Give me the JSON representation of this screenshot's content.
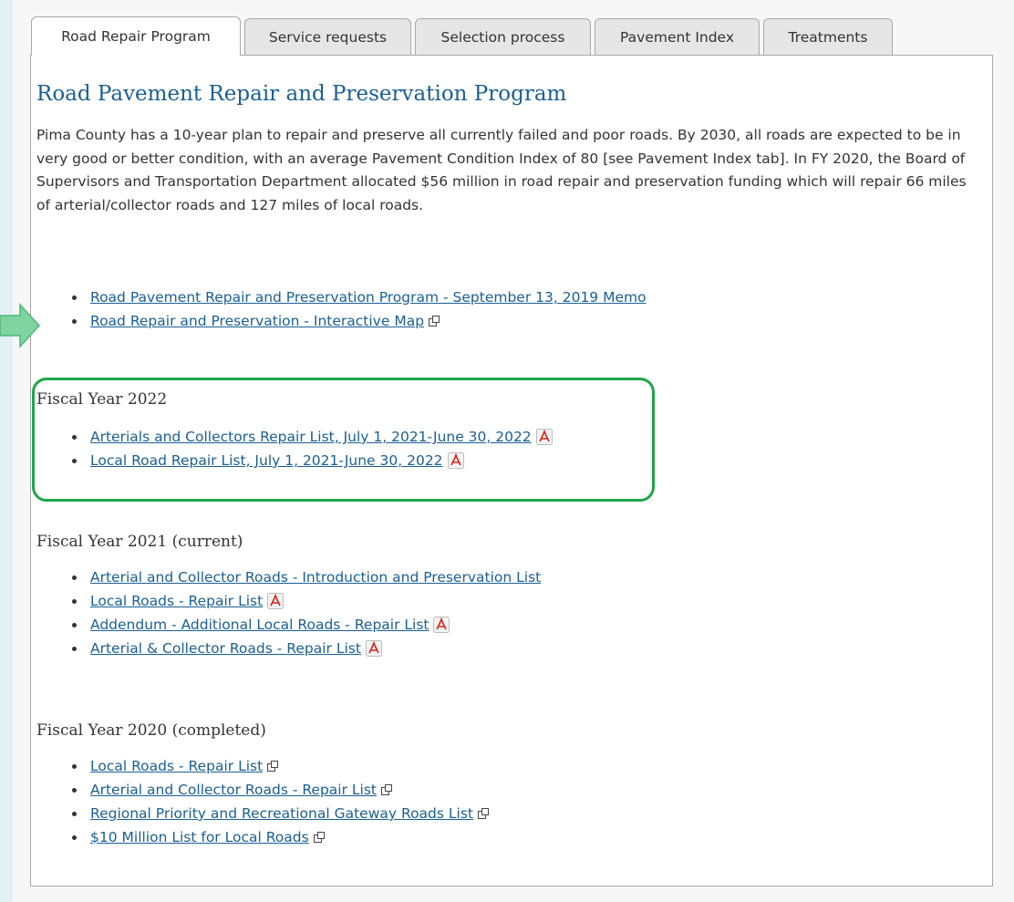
{
  "tabs": [
    {
      "label": "Road Repair Program",
      "active": true
    },
    {
      "label": "Service requests",
      "active": false
    },
    {
      "label": "Selection process",
      "active": false
    },
    {
      "label": "Pavement Index",
      "active": false
    },
    {
      "label": "Treatments",
      "active": false
    }
  ],
  "page": {
    "heading": "Road Pavement Repair and Preservation Program",
    "intro": "Pima County has a 10-year plan to repair and preserve all currently failed and poor roads.  By 2030, all roads are expected to be in very good or better condition, with an average Pavement Condition Index of 80 [see Pavement Index tab].  In FY 2020, the Board of Supervisors and Transportation Department allocated $56 million in road repair and preservation funding which will repair 66 miles of arterial/collector roads and 127 miles of local roads."
  },
  "top_links": [
    {
      "label": "Road Pavement Repair and Preservation Program - September 13, 2019 Memo",
      "icon": ""
    },
    {
      "label": "Road Repair and Preservation - Interactive Map",
      "icon": "external-link-icon"
    }
  ],
  "fy2022": {
    "title": "Fiscal Year 2022",
    "links": [
      {
        "label": "Arterials and Collectors Repair List, July 1, 2021-June 30, 2022",
        "icon": "pdf-icon"
      },
      {
        "label": "Local Road Repair List, July 1, 2021-June 30, 2022",
        "icon": "pdf-icon"
      }
    ]
  },
  "fy2021": {
    "title": "Fiscal Year 2021 (current)",
    "links": [
      {
        "label": "Arterial and Collector Roads - Introduction and Preservation List",
        "icon": ""
      },
      {
        "label": "Local Roads - Repair List",
        "icon": "pdf-icon"
      },
      {
        "label": "Addendum - Additional Local Roads - Repair List",
        "icon": "pdf-icon"
      },
      {
        "label": "Arterial & Collector Roads - Repair List",
        "icon": "pdf-icon"
      }
    ]
  },
  "fy2020": {
    "title": "Fiscal Year 2020 (completed)",
    "links": [
      {
        "label": "Local Roads - Repair List",
        "icon": "external-link-icon"
      },
      {
        "label": "Arterial and Collector Roads - Repair List",
        "icon": "external-link-icon"
      },
      {
        "label": "Regional Priority and Recreational Gateway Roads List",
        "icon": "external-link-icon"
      },
      {
        "label": "$10 Million List for Local Roads",
        "icon": "external-link-icon"
      }
    ]
  },
  "annotations": {
    "arrow_color": "#7ed3a0",
    "highlight_color": "#1fa64a"
  },
  "colors": {
    "link": "#1a5f93",
    "heading": "#1a5f93",
    "text": "#333333",
    "pdf_red": "#d9221c"
  }
}
